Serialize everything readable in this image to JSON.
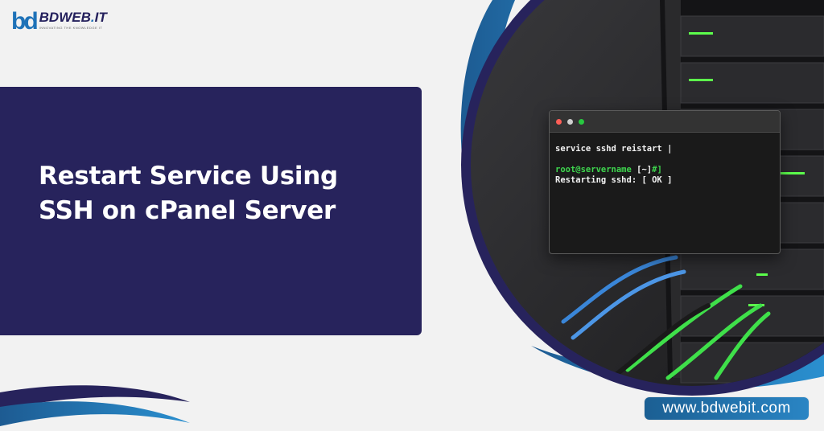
{
  "logo": {
    "mark": "bd",
    "word": "BDWEB",
    "dot": ".",
    "suffix": "IT",
    "tagline": "INNOVATING THE KNOWLEDGE IT"
  },
  "title": {
    "line1": "Restart Service Using",
    "line2": "SSH on cPanel Server"
  },
  "terminal": {
    "line1": "service sshd reistart |",
    "line2_user": "root@servername",
    "line2_path": " [~]",
    "line2_prompt": "#]",
    "line3": "Restarting sshd: [ OK ]"
  },
  "footer": {
    "url": "www.bdwebit.com"
  },
  "colors": {
    "navy": "#27235c",
    "brand_blue": "#1e72b8",
    "teal": "#2a85c4",
    "terminal_green": "#3ed64e"
  }
}
